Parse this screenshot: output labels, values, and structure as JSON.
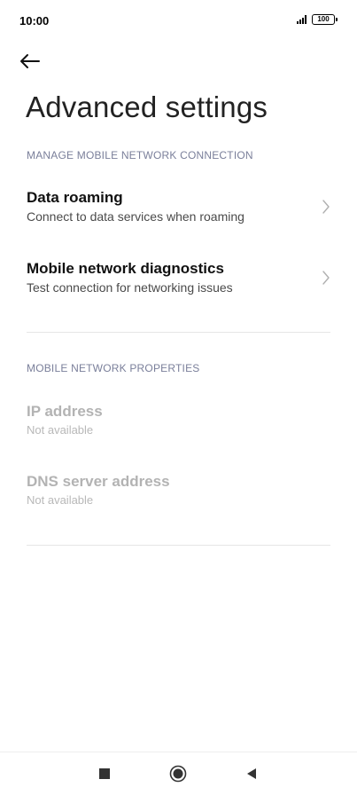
{
  "status_bar": {
    "time": "10:00",
    "battery": "100",
    "icons": [
      "signal-icon",
      "battery-icon"
    ]
  },
  "header": {
    "back_icon": "back-arrow-icon",
    "title": "Advanced settings"
  },
  "sections": [
    {
      "header": "MANAGE MOBILE NETWORK CONNECTION",
      "items": [
        {
          "title": "Data roaming",
          "subtitle": "Connect to data services when roaming",
          "enabled": true
        },
        {
          "title": "Mobile network diagnostics",
          "subtitle": "Test connection for networking issues",
          "enabled": true
        }
      ]
    },
    {
      "header": "MOBILE NETWORK PROPERTIES",
      "items": [
        {
          "title": "IP address",
          "subtitle": "Not available",
          "enabled": false
        },
        {
          "title": "DNS server address",
          "subtitle": "Not available",
          "enabled": false
        }
      ]
    }
  ],
  "nav_bar": {
    "icons": [
      "recents-square-icon",
      "home-circle-icon",
      "back-triangle-icon"
    ]
  },
  "colors": {
    "section_header": "#7a7f9a",
    "disabled_text": "#b3b3b3",
    "divider": "#e6e6e6"
  }
}
